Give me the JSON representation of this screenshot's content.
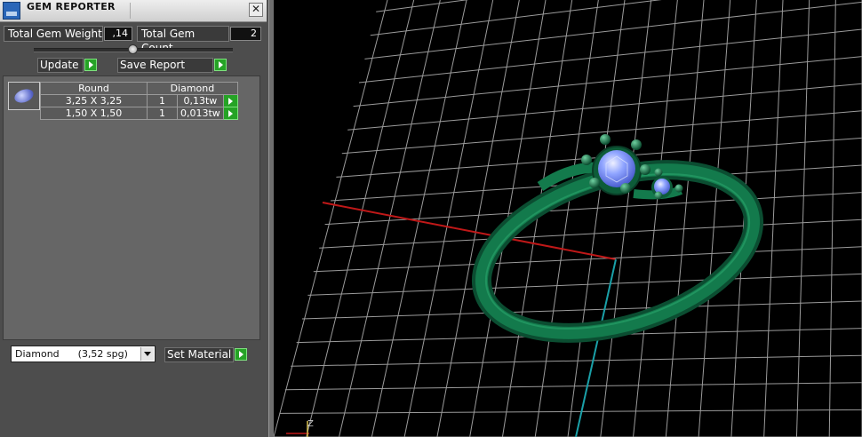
{
  "window": {
    "title": "GEM REPORTER",
    "close_glyph": "✕"
  },
  "totals": {
    "weight_label": "Total Gem Weight",
    "weight_value": ",14",
    "count_label": "Total Gem Count",
    "count_value": "2"
  },
  "toolbar": {
    "update_label": "Update",
    "save_report_label": "Save Report"
  },
  "gem_table": {
    "headers": [
      "Round",
      "Diamond"
    ],
    "rows": [
      {
        "size": "3,25 X 3,25",
        "qty": "1",
        "weight": "0,13tw"
      },
      {
        "size": "1,50 X 1,50",
        "qty": "1",
        "weight": "0,013tw"
      }
    ]
  },
  "material": {
    "selected": "Diamond      (3,52 spg)",
    "set_label": "Set Material"
  },
  "viewport": {
    "axis_label": "Z",
    "colors": {
      "ring": "#0f6a42",
      "gem": "#8fa4ff",
      "x_axis": "#c01818",
      "z_axis": "#1aa0a8",
      "grid": "#d0d0d0"
    }
  },
  "icons": [
    "gem-reporter-app-icon",
    "close-icon",
    "play-arrow-icon",
    "dropdown-arrow-icon",
    "gem-thumbnail-icon"
  ]
}
